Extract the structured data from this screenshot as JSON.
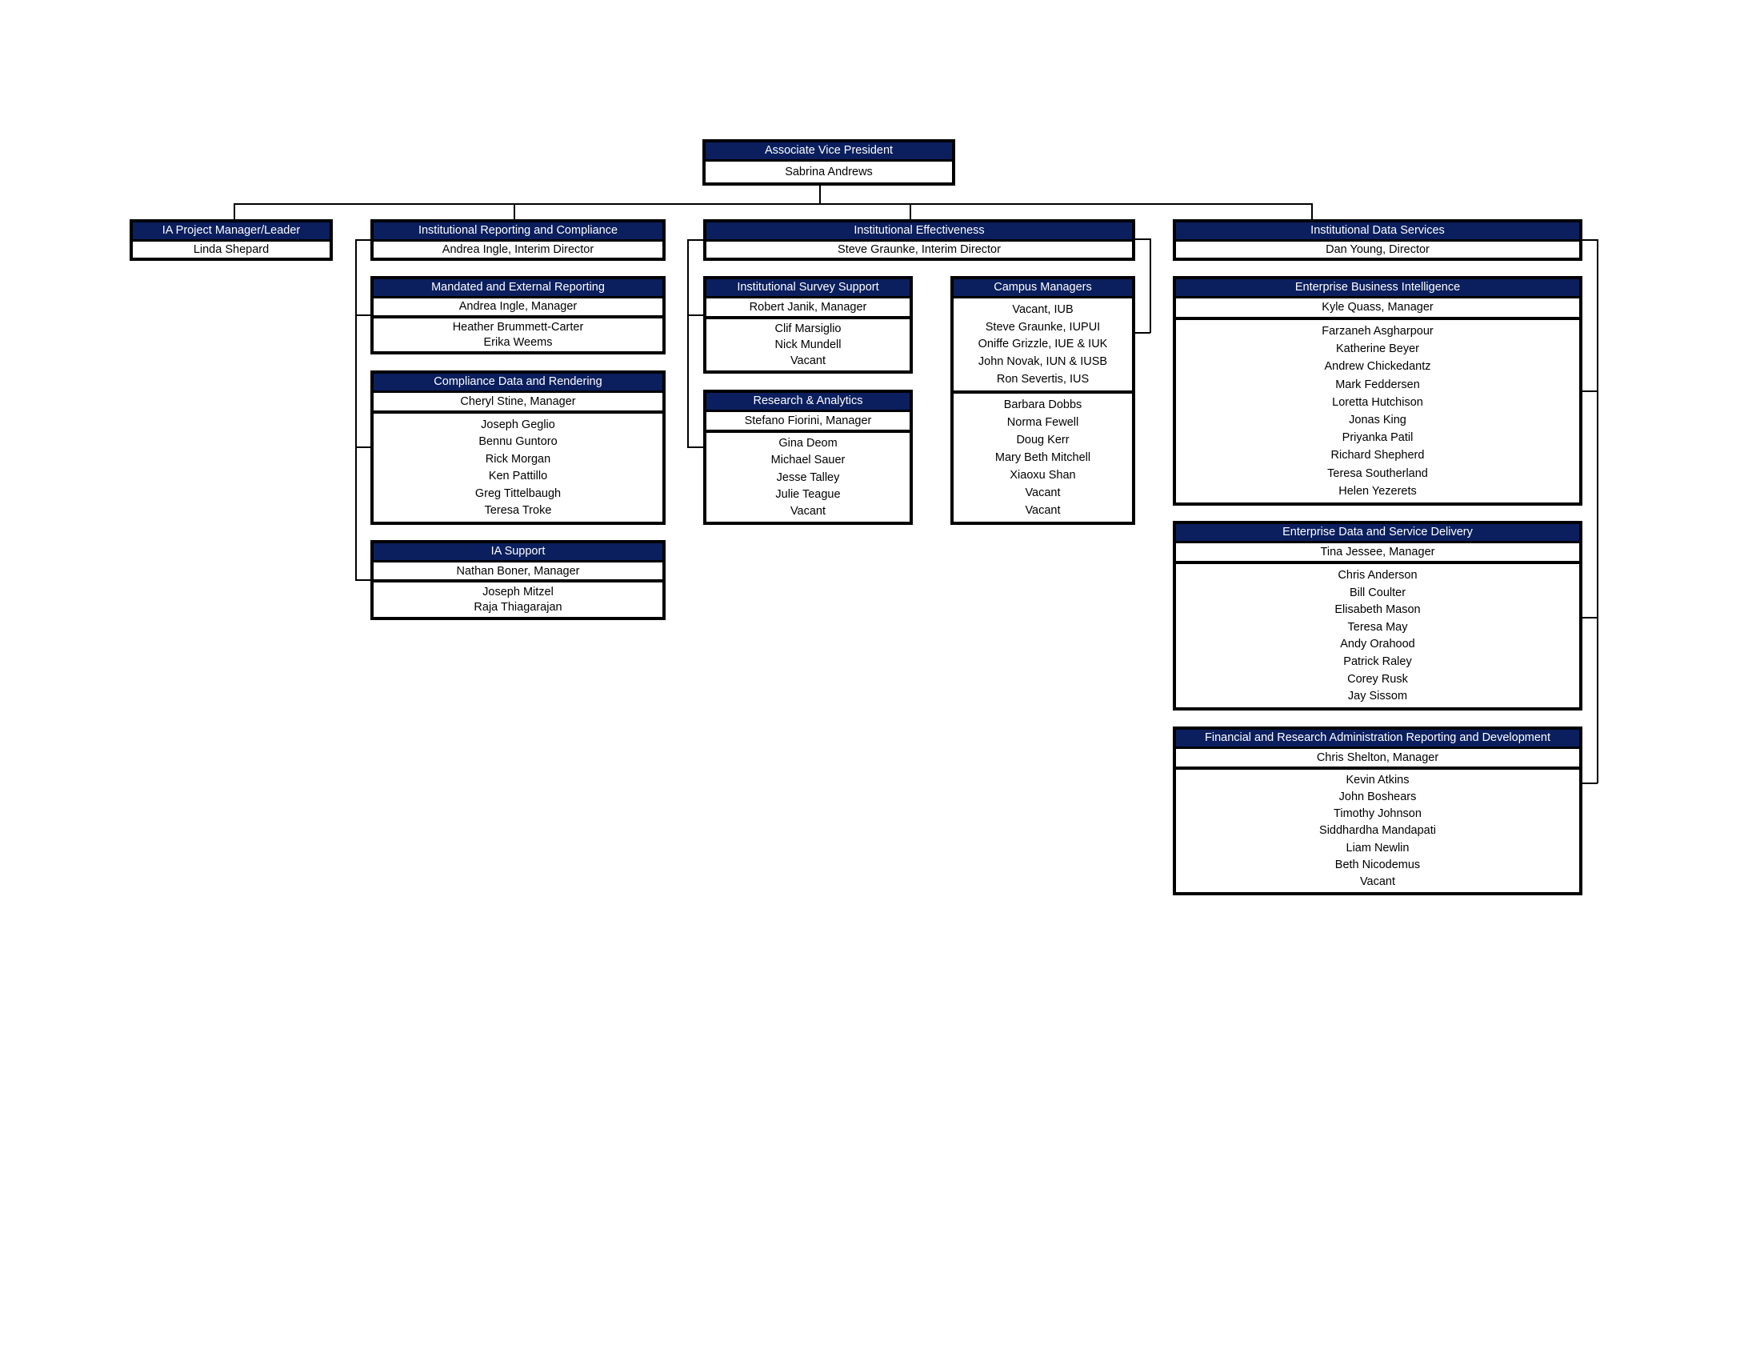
{
  "boxes": {
    "avp": {
      "title": "Associate Vice President",
      "sections": [
        [
          "Sabrina Andrews"
        ]
      ]
    },
    "ia_project": {
      "title": "IA Project Manager/Leader",
      "sections": [
        [
          "Linda Shepard"
        ]
      ]
    },
    "irc": {
      "title": "Institutional Reporting and Compliance",
      "sections": [
        [
          "Andrea Ingle, Interim Director"
        ]
      ]
    },
    "mandated": {
      "title": "Mandated and External Reporting",
      "sections": [
        [
          "Andrea Ingle, Manager"
        ],
        [
          "Heather Brummett-Carter",
          "Erika Weems"
        ]
      ]
    },
    "compliance": {
      "title": "Compliance Data and Rendering",
      "sections": [
        [
          "Cheryl Stine, Manager"
        ],
        [
          "Joseph Geglio",
          "Bennu Guntoro",
          "Rick Morgan",
          "Ken Pattillo",
          "Greg Tittelbaugh",
          "Teresa Troke"
        ]
      ]
    },
    "ia_support": {
      "title": "IA Support",
      "sections": [
        [
          "Nathan Boner, Manager"
        ],
        [
          "Joseph Mitzel",
          "Raja Thiagarajan"
        ]
      ]
    },
    "ie": {
      "title": "Institutional Effectiveness",
      "sections": [
        [
          "Steve Graunke, Interim Director"
        ]
      ]
    },
    "survey": {
      "title": "Institutional Survey Support",
      "sections": [
        [
          "Robert Janik, Manager"
        ],
        [
          "Clif Marsiglio",
          "Nick Mundell",
          "Vacant"
        ]
      ]
    },
    "research": {
      "title": "Research & Analytics",
      "sections": [
        [
          "Stefano Fiorini, Manager"
        ],
        [
          "Gina Deom",
          "Michael Sauer",
          "Jesse Talley",
          "Julie Teague",
          "Vacant"
        ]
      ]
    },
    "campus": {
      "title": "Campus Managers",
      "sections": [
        [
          "Vacant, IUB",
          "Steve Graunke, IUPUI",
          "Oniffe Grizzle, IUE & IUK",
          "John Novak, IUN & IUSB",
          "Ron Severtis, IUS"
        ],
        [
          "Barbara Dobbs",
          "Norma Fewell",
          "Doug Kerr",
          "Mary Beth Mitchell",
          "Xiaoxu Shan",
          "Vacant",
          "Vacant"
        ]
      ]
    },
    "ids": {
      "title": "Institutional Data Services",
      "sections": [
        [
          "Dan Young, Director"
        ]
      ]
    },
    "ebi": {
      "title": "Enterprise Business Intelligence",
      "sections": [
        [
          "Kyle Quass, Manager"
        ],
        [
          "Farzaneh Asgharpour",
          "Katherine Beyer",
          "Andrew Chickedantz",
          "Mark Feddersen",
          "Loretta Hutchison",
          "Jonas King",
          "Priyanka Patil",
          "Richard Shepherd",
          "Teresa Southerland",
          "Helen Yezerets"
        ]
      ]
    },
    "edsd": {
      "title": "Enterprise Data and Service Delivery",
      "sections": [
        [
          "Tina Jessee, Manager"
        ],
        [
          "Chris Anderson",
          "Bill Coulter",
          "Elisabeth Mason",
          "Teresa May",
          "Andy Orahood",
          "Patrick Raley",
          "Corey Rusk",
          "Jay Sissom"
        ]
      ]
    },
    "frard": {
      "title": "Financial and Research Administration Reporting and Development",
      "sections": [
        [
          "Chris Shelton, Manager"
        ],
        [
          "Kevin Atkins",
          "John Boshears",
          "Timothy Johnson",
          "Siddhardha Mandapati",
          "Liam Newlin",
          "Beth Nicodemus",
          "Vacant"
        ]
      ]
    }
  },
  "colors": {
    "header_bg": "#0b1f5e",
    "border": "#000000"
  }
}
